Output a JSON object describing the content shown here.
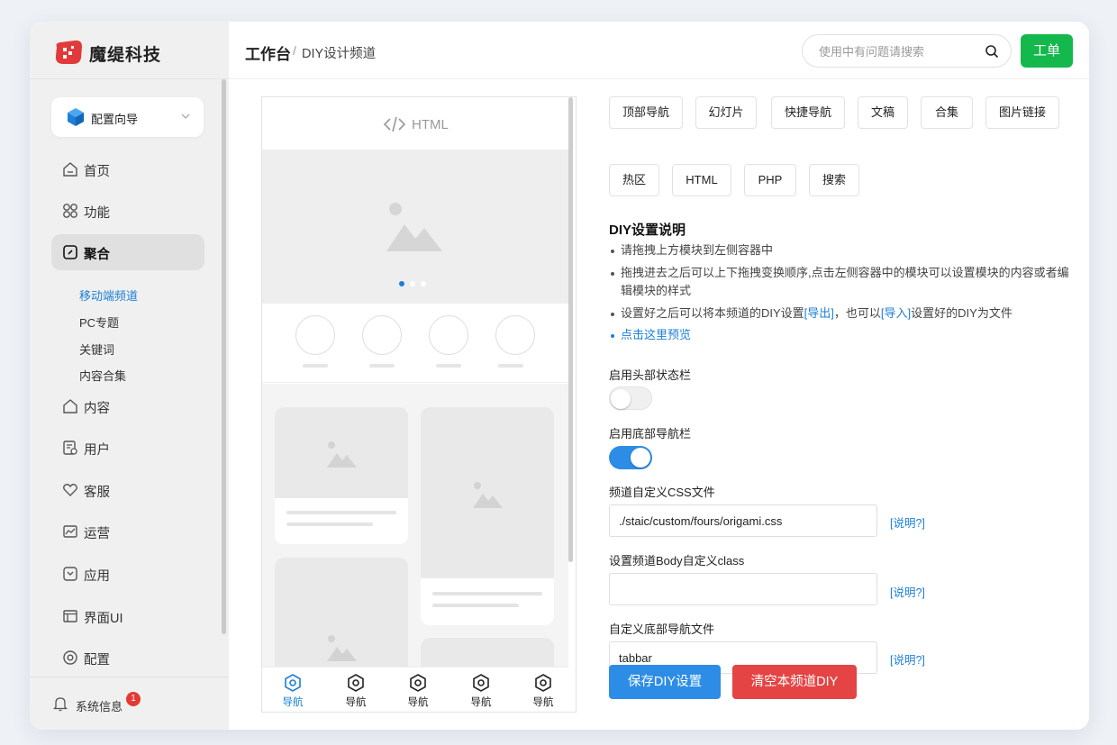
{
  "brand": {
    "name": "魔缇科技"
  },
  "sidebar": {
    "wizard_label": "配置向导",
    "items": [
      {
        "label": "首页",
        "icon": "home-icon"
      },
      {
        "label": "功能",
        "icon": "apps-icon"
      },
      {
        "label": "聚合",
        "icon": "aggregate-icon"
      },
      {
        "label": "内容",
        "icon": "content-icon"
      },
      {
        "label": "用户",
        "icon": "user-icon"
      },
      {
        "label": "客服",
        "icon": "heart-icon"
      },
      {
        "label": "运营",
        "icon": "chart-icon"
      },
      {
        "label": "应用",
        "icon": "app-icon"
      },
      {
        "label": "界面UI",
        "icon": "layout-icon"
      },
      {
        "label": "配置",
        "icon": "settings-icon"
      }
    ],
    "sub_items": [
      "移动端频道",
      "PC专题",
      "关键词",
      "内容合集"
    ],
    "system_info": "系统信息",
    "badge_count": "1"
  },
  "header": {
    "breadcrumb_main": "工作台",
    "breadcrumb_sep": "/",
    "breadcrumb_sub": "DIY设计频道",
    "search_placeholder": "使用中有问题请搜索",
    "ticket_label": "工单"
  },
  "preview": {
    "header_text": "HTML",
    "tabs": [
      "导航",
      "导航",
      "导航",
      "导航",
      "导航"
    ]
  },
  "modules": [
    "顶部导航",
    "幻灯片",
    "快捷导航",
    "文稿",
    "合集",
    "图片链接",
    "热区",
    "HTML",
    "PHP",
    "搜索"
  ],
  "instructions": {
    "title": "DIY设置说明",
    "line1": "请拖拽上方模块到左侧容器中",
    "line2": "拖拽进去之后可以上下拖拽变换顺序,点击左侧容器中的模块可以设置模块的内容或者编辑模块的样式",
    "line3_pre": "设置好之后可以将本频道的DIY设置",
    "export_link": "[导出]",
    "line3_mid": "，也可以",
    "import_link": "[导入]",
    "line3_post": "设置好的DIY为文件",
    "preview_link": "点击这里预览"
  },
  "form": {
    "header_bar_label": "启用头部状态栏",
    "header_bar_enabled": false,
    "bottom_nav_label": "启用底部导航栏",
    "bottom_nav_enabled": true,
    "css_label": "频道自定义CSS文件",
    "css_value": "./staic/custom/fours/origami.css",
    "body_class_label": "设置频道Body自定义class",
    "body_class_value": "",
    "nav_file_label": "自定义底部导航文件",
    "nav_file_value": "tabbar",
    "help_label": "[说明?]"
  },
  "actions": {
    "save": "保存DIY设置",
    "clear": "清空本频道DIY"
  },
  "colors": {
    "accent": "#1d7fd6",
    "save": "#2d8de6",
    "clear": "#e54444",
    "ticket": "#15b84c",
    "toggle_on": "#2d8de6",
    "toggle_off": "#f0f0f0"
  }
}
